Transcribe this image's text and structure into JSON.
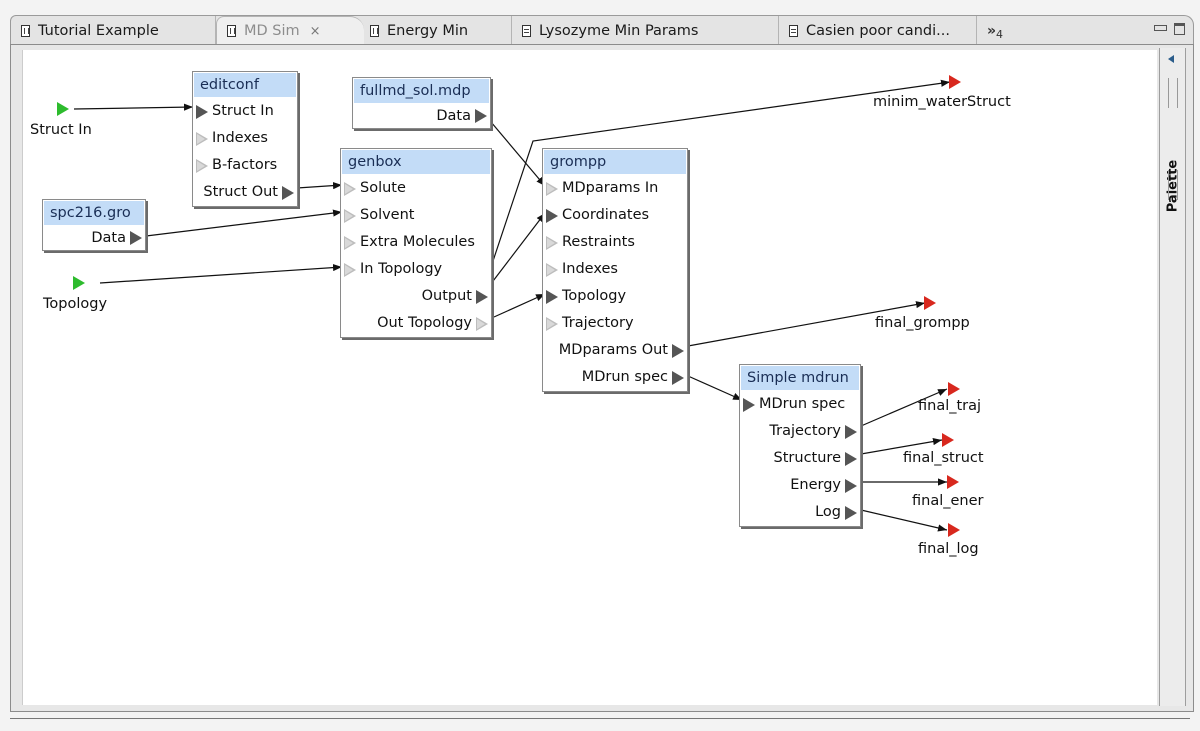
{
  "tabs": [
    {
      "label": "Tutorial Example",
      "icon": "workflow-file-icon",
      "active": false
    },
    {
      "label": "MD Sim",
      "icon": "workflow-file-icon",
      "active": true,
      "close_icon": "×"
    },
    {
      "label": "Energy Min",
      "icon": "workflow-file-icon",
      "active": false
    },
    {
      "label": "Lysozyme Min Params",
      "icon": "text-file-icon",
      "active": false
    },
    {
      "label": "Casien poor candi...",
      "icon": "text-file-icon",
      "active": false
    }
  ],
  "overflow": {
    "chevron": "»",
    "count": "4"
  },
  "palette": {
    "label": "Palette"
  },
  "colors": {
    "node_title_bg": "#c3dcf7",
    "input_terminal": "#2dbb2d",
    "output_terminal": "#d8281e",
    "connected_port": "#555555",
    "unconnected_port": "#bdbdbd"
  },
  "inputs": [
    {
      "id": "in_struct",
      "label": "Struct In"
    },
    {
      "id": "in_topology",
      "label": "Topology"
    }
  ],
  "outputs": [
    {
      "id": "out_minim",
      "label": "minim_waterStruct"
    },
    {
      "id": "out_grompp",
      "label": "final_grompp"
    },
    {
      "id": "out_traj",
      "label": "final_traj"
    },
    {
      "id": "out_struct",
      "label": "final_struct"
    },
    {
      "id": "out_ener",
      "label": "final_ener"
    },
    {
      "id": "out_log",
      "label": "final_log"
    }
  ],
  "nodes": {
    "editconf": {
      "title": "editconf",
      "ports": [
        {
          "label": "Struct In",
          "dir": "in",
          "connected": true
        },
        {
          "label": "Indexes",
          "dir": "in",
          "connected": false
        },
        {
          "label": "B-factors",
          "dir": "in",
          "connected": false
        },
        {
          "label": "Struct Out",
          "dir": "out",
          "connected": true
        }
      ]
    },
    "spc216": {
      "title": "spc216.gro",
      "ports": [
        {
          "label": "Data",
          "dir": "out",
          "connected": true
        }
      ]
    },
    "fullmd": {
      "title": "fullmd_sol.mdp",
      "ports": [
        {
          "label": "Data",
          "dir": "out",
          "connected": true
        }
      ]
    },
    "genbox": {
      "title": "genbox",
      "ports": [
        {
          "label": "Solute",
          "dir": "in",
          "connected": false
        },
        {
          "label": "Solvent",
          "dir": "in",
          "connected": false
        },
        {
          "label": "Extra Molecules",
          "dir": "in",
          "connected": false
        },
        {
          "label": "In Topology",
          "dir": "in",
          "connected": false
        },
        {
          "label": "Output",
          "dir": "out",
          "connected": true
        },
        {
          "label": "Out Topology",
          "dir": "out",
          "connected": false
        }
      ]
    },
    "grompp": {
      "title": "grompp",
      "ports": [
        {
          "label": "MDparams In",
          "dir": "in",
          "connected": false
        },
        {
          "label": "Coordinates",
          "dir": "in",
          "connected": true
        },
        {
          "label": "Restraints",
          "dir": "in",
          "connected": false
        },
        {
          "label": "Indexes",
          "dir": "in",
          "connected": false
        },
        {
          "label": "Topology",
          "dir": "in",
          "connected": true
        },
        {
          "label": "Trajectory",
          "dir": "in",
          "connected": false
        },
        {
          "label": "MDparams Out",
          "dir": "out",
          "connected": true
        },
        {
          "label": "MDrun spec",
          "dir": "out",
          "connected": true
        }
      ]
    },
    "mdrun": {
      "title": "Simple mdrun",
      "ports": [
        {
          "label": "MDrun spec",
          "dir": "in",
          "connected": true
        },
        {
          "label": "Trajectory",
          "dir": "out",
          "connected": true
        },
        {
          "label": "Structure",
          "dir": "out",
          "connected": true
        },
        {
          "label": "Energy",
          "dir": "out",
          "connected": true
        },
        {
          "label": "Log",
          "dir": "out",
          "connected": true
        }
      ]
    }
  },
  "connections": [
    {
      "from": "Struct In (input)",
      "to": "editconf.Struct In"
    },
    {
      "from": "editconf.Struct Out",
      "to": "genbox.Solute"
    },
    {
      "from": "spc216.gro.Data",
      "to": "genbox.Solvent"
    },
    {
      "from": "Topology (input)",
      "to": "genbox.In Topology"
    },
    {
      "from": "fullmd_sol.mdp.Data",
      "to": "grompp.MDparams In"
    },
    {
      "from": "genbox.Output",
      "to": "minim_waterStruct"
    },
    {
      "from": "genbox.Output",
      "to": "grompp.Coordinates"
    },
    {
      "from": "genbox.Out Topology",
      "to": "grompp.Topology"
    },
    {
      "from": "grompp.MDparams Out",
      "to": "final_grompp"
    },
    {
      "from": "grompp.MDrun spec",
      "to": "Simple mdrun.MDrun spec"
    },
    {
      "from": "Simple mdrun.Trajectory",
      "to": "final_traj"
    },
    {
      "from": "Simple mdrun.Structure",
      "to": "final_struct"
    },
    {
      "from": "Simple mdrun.Energy",
      "to": "final_ener"
    },
    {
      "from": "Simple mdrun.Log",
      "to": "final_log"
    }
  ]
}
